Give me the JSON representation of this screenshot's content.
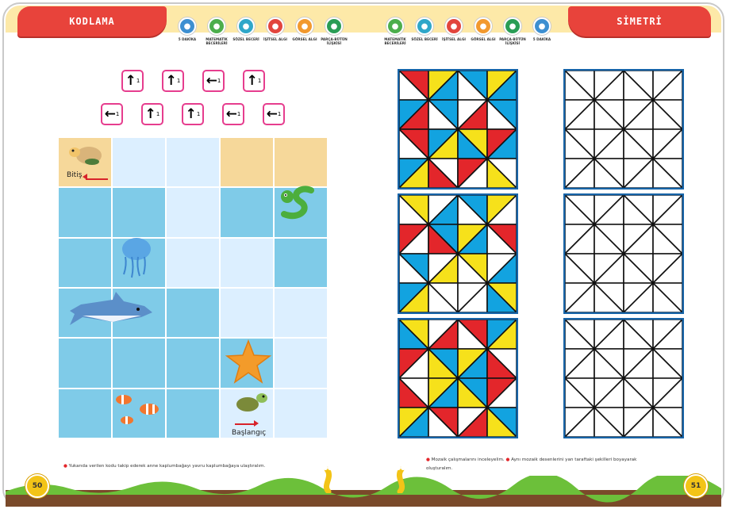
{
  "header": {
    "left_title": "KODLAMA",
    "right_title": "SİMETRİ",
    "left_skills": [
      {
        "icon": "clock-icon",
        "label": "5 DAKİKA",
        "color": "#3d8fd1"
      },
      {
        "icon": "calculator-icon",
        "label": "MATEMATİK BECERİLERİ",
        "color": "#4cae4c"
      },
      {
        "icon": "speech-icon",
        "label": "SÖZEL BECERİ",
        "color": "#2fa7c9"
      },
      {
        "icon": "ear-icon",
        "label": "İŞİTSEL ALGI",
        "color": "#e2453d"
      },
      {
        "icon": "eye-icon",
        "label": "GÖRSEL ALGI",
        "color": "#f2992e"
      },
      {
        "icon": "puzzle-icon",
        "label": "PARÇA-BÜTÜN İLİŞKİSİ",
        "color": "#2a9d55"
      }
    ],
    "right_skills": [
      {
        "icon": "calculator-icon",
        "label": "MATEMATİK BECERİLERİ",
        "color": "#4cae4c"
      },
      {
        "icon": "speech-icon",
        "label": "SÖZEL BECERİ",
        "color": "#2fa7c9"
      },
      {
        "icon": "ear-icon",
        "label": "İŞİTSEL ALGI",
        "color": "#e2453d"
      },
      {
        "icon": "eye-icon",
        "label": "GÖRSEL ALGI",
        "color": "#f2992e"
      },
      {
        "icon": "puzzle-icon",
        "label": "PARÇA-BÜTÜN İLİŞKİSİ",
        "color": "#2a9d55"
      },
      {
        "icon": "clock-icon",
        "label": "5 DAKİKA",
        "color": "#3d8fd1"
      }
    ]
  },
  "code": {
    "row1": [
      {
        "dir": "up",
        "glyph": "↑",
        "n": "1"
      },
      {
        "dir": "up",
        "glyph": "↑",
        "n": "1"
      },
      {
        "dir": "left",
        "glyph": "←",
        "n": "1"
      },
      {
        "dir": "up",
        "glyph": "↑",
        "n": "1"
      }
    ],
    "row2": [
      {
        "dir": "left",
        "glyph": "←",
        "n": "1"
      },
      {
        "dir": "up",
        "glyph": "↑",
        "n": "1"
      },
      {
        "dir": "up",
        "glyph": "↑",
        "n": "1"
      },
      {
        "dir": "left",
        "glyph": "←",
        "n": "1"
      },
      {
        "dir": "left",
        "glyph": "←",
        "n": "1"
      }
    ]
  },
  "grid": {
    "finish_label": "Bitiş",
    "start_label": "Başlangıç",
    "rows": [
      [
        "sand",
        "path",
        "path",
        "sand",
        "sand"
      ],
      [
        "water",
        "water",
        "path",
        "water",
        "water"
      ],
      [
        "water",
        "water",
        "path",
        "path",
        "water"
      ],
      [
        "water",
        "water",
        "water",
        "path",
        "path"
      ],
      [
        "water",
        "water",
        "water",
        "water",
        "path"
      ],
      [
        "water",
        "water",
        "water",
        "path",
        "path"
      ]
    ]
  },
  "colors": {
    "red": "#e3262b",
    "blue": "#12a3e0",
    "yellow": "#f6e11b",
    "white": "#ffffff",
    "frame": "#1664a8"
  },
  "patterns": [
    [
      [
        "R",
        "W",
        "Y",
        "B",
        "B",
        "W",
        "Y",
        "B",
        "R",
        "W",
        "R",
        "B",
        "W",
        "R"
      ],
      [
        "B",
        "R",
        "B",
        "W",
        "W",
        "R",
        "B",
        "W",
        "B",
        "Y",
        "B",
        "W",
        "B",
        "R"
      ],
      [
        "R",
        "W",
        "B",
        "Y",
        "Y",
        "B",
        "R",
        "B",
        "W",
        "R",
        "W",
        "R",
        "B",
        "Y"
      ],
      [
        "B",
        "Y",
        "W",
        "R",
        "R",
        "W",
        "W",
        "Y",
        "R",
        "B",
        "W",
        "R",
        "W",
        "R"
      ]
    ],
    [
      [
        "Y",
        "W",
        "W",
        "B",
        "B",
        "W",
        "Y",
        "W"
      ],
      [
        "R",
        "W",
        "B",
        "R",
        "Y",
        "B",
        "R",
        "W"
      ],
      [
        "B",
        "W",
        "W",
        "Y",
        "Y",
        "W",
        "W",
        "B"
      ],
      [
        "B",
        "Y",
        "W",
        "W",
        "W",
        "W",
        "Y",
        "B"
      ]
    ],
    [
      [
        "Y",
        "B",
        "W",
        "R",
        "R",
        "W",
        "B",
        "Y"
      ],
      [
        "R",
        "W",
        "B",
        "Y",
        "Y",
        "B",
        "W",
        "R"
      ],
      [
        "W",
        "R",
        "Y",
        "B",
        "B",
        "Y",
        "R",
        "W"
      ],
      [
        "Y",
        "B",
        "R",
        "W",
        "W",
        "R",
        "B",
        "Y"
      ]
    ]
  ],
  "footer": {
    "left_instruction": "Yukarıda verilen kodu takip ederek anne kaplumbağayı yavru kaplumbağaya ulaştıralım.",
    "right_instruction_1": "Mozaik çalışmalarını inceleyelim.",
    "right_instruction_2": "Aynı mozaik desenlerini yan taraftaki şekilleri boyayarak oluşturalım.",
    "left_page": "50",
    "right_page": "51"
  }
}
